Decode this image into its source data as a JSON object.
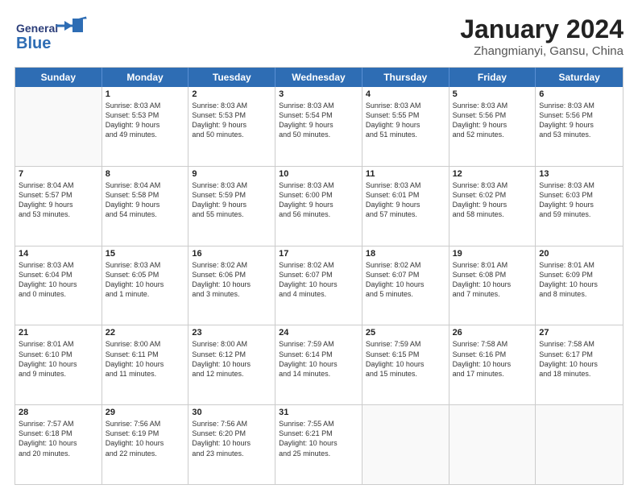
{
  "logo": {
    "general": "General",
    "blue": "Blue"
  },
  "title": "January 2024",
  "subtitle": "Zhangmianyi, Gansu, China",
  "header_days": [
    "Sunday",
    "Monday",
    "Tuesday",
    "Wednesday",
    "Thursday",
    "Friday",
    "Saturday"
  ],
  "weeks": [
    [
      {
        "day": "",
        "lines": []
      },
      {
        "day": "1",
        "lines": [
          "Sunrise: 8:03 AM",
          "Sunset: 5:53 PM",
          "Daylight: 9 hours",
          "and 49 minutes."
        ]
      },
      {
        "day": "2",
        "lines": [
          "Sunrise: 8:03 AM",
          "Sunset: 5:53 PM",
          "Daylight: 9 hours",
          "and 50 minutes."
        ]
      },
      {
        "day": "3",
        "lines": [
          "Sunrise: 8:03 AM",
          "Sunset: 5:54 PM",
          "Daylight: 9 hours",
          "and 50 minutes."
        ]
      },
      {
        "day": "4",
        "lines": [
          "Sunrise: 8:03 AM",
          "Sunset: 5:55 PM",
          "Daylight: 9 hours",
          "and 51 minutes."
        ]
      },
      {
        "day": "5",
        "lines": [
          "Sunrise: 8:03 AM",
          "Sunset: 5:56 PM",
          "Daylight: 9 hours",
          "and 52 minutes."
        ]
      },
      {
        "day": "6",
        "lines": [
          "Sunrise: 8:03 AM",
          "Sunset: 5:56 PM",
          "Daylight: 9 hours",
          "and 53 minutes."
        ]
      }
    ],
    [
      {
        "day": "7",
        "lines": [
          "Sunrise: 8:04 AM",
          "Sunset: 5:57 PM",
          "Daylight: 9 hours",
          "and 53 minutes."
        ]
      },
      {
        "day": "8",
        "lines": [
          "Sunrise: 8:04 AM",
          "Sunset: 5:58 PM",
          "Daylight: 9 hours",
          "and 54 minutes."
        ]
      },
      {
        "day": "9",
        "lines": [
          "Sunrise: 8:03 AM",
          "Sunset: 5:59 PM",
          "Daylight: 9 hours",
          "and 55 minutes."
        ]
      },
      {
        "day": "10",
        "lines": [
          "Sunrise: 8:03 AM",
          "Sunset: 6:00 PM",
          "Daylight: 9 hours",
          "and 56 minutes."
        ]
      },
      {
        "day": "11",
        "lines": [
          "Sunrise: 8:03 AM",
          "Sunset: 6:01 PM",
          "Daylight: 9 hours",
          "and 57 minutes."
        ]
      },
      {
        "day": "12",
        "lines": [
          "Sunrise: 8:03 AM",
          "Sunset: 6:02 PM",
          "Daylight: 9 hours",
          "and 58 minutes."
        ]
      },
      {
        "day": "13",
        "lines": [
          "Sunrise: 8:03 AM",
          "Sunset: 6:03 PM",
          "Daylight: 9 hours",
          "and 59 minutes."
        ]
      }
    ],
    [
      {
        "day": "14",
        "lines": [
          "Sunrise: 8:03 AM",
          "Sunset: 6:04 PM",
          "Daylight: 10 hours",
          "and 0 minutes."
        ]
      },
      {
        "day": "15",
        "lines": [
          "Sunrise: 8:03 AM",
          "Sunset: 6:05 PM",
          "Daylight: 10 hours",
          "and 1 minute."
        ]
      },
      {
        "day": "16",
        "lines": [
          "Sunrise: 8:02 AM",
          "Sunset: 6:06 PM",
          "Daylight: 10 hours",
          "and 3 minutes."
        ]
      },
      {
        "day": "17",
        "lines": [
          "Sunrise: 8:02 AM",
          "Sunset: 6:07 PM",
          "Daylight: 10 hours",
          "and 4 minutes."
        ]
      },
      {
        "day": "18",
        "lines": [
          "Sunrise: 8:02 AM",
          "Sunset: 6:07 PM",
          "Daylight: 10 hours",
          "and 5 minutes."
        ]
      },
      {
        "day": "19",
        "lines": [
          "Sunrise: 8:01 AM",
          "Sunset: 6:08 PM",
          "Daylight: 10 hours",
          "and 7 minutes."
        ]
      },
      {
        "day": "20",
        "lines": [
          "Sunrise: 8:01 AM",
          "Sunset: 6:09 PM",
          "Daylight: 10 hours",
          "and 8 minutes."
        ]
      }
    ],
    [
      {
        "day": "21",
        "lines": [
          "Sunrise: 8:01 AM",
          "Sunset: 6:10 PM",
          "Daylight: 10 hours",
          "and 9 minutes."
        ]
      },
      {
        "day": "22",
        "lines": [
          "Sunrise: 8:00 AM",
          "Sunset: 6:11 PM",
          "Daylight: 10 hours",
          "and 11 minutes."
        ]
      },
      {
        "day": "23",
        "lines": [
          "Sunrise: 8:00 AM",
          "Sunset: 6:12 PM",
          "Daylight: 10 hours",
          "and 12 minutes."
        ]
      },
      {
        "day": "24",
        "lines": [
          "Sunrise: 7:59 AM",
          "Sunset: 6:14 PM",
          "Daylight: 10 hours",
          "and 14 minutes."
        ]
      },
      {
        "day": "25",
        "lines": [
          "Sunrise: 7:59 AM",
          "Sunset: 6:15 PM",
          "Daylight: 10 hours",
          "and 15 minutes."
        ]
      },
      {
        "day": "26",
        "lines": [
          "Sunrise: 7:58 AM",
          "Sunset: 6:16 PM",
          "Daylight: 10 hours",
          "and 17 minutes."
        ]
      },
      {
        "day": "27",
        "lines": [
          "Sunrise: 7:58 AM",
          "Sunset: 6:17 PM",
          "Daylight: 10 hours",
          "and 18 minutes."
        ]
      }
    ],
    [
      {
        "day": "28",
        "lines": [
          "Sunrise: 7:57 AM",
          "Sunset: 6:18 PM",
          "Daylight: 10 hours",
          "and 20 minutes."
        ]
      },
      {
        "day": "29",
        "lines": [
          "Sunrise: 7:56 AM",
          "Sunset: 6:19 PM",
          "Daylight: 10 hours",
          "and 22 minutes."
        ]
      },
      {
        "day": "30",
        "lines": [
          "Sunrise: 7:56 AM",
          "Sunset: 6:20 PM",
          "Daylight: 10 hours",
          "and 23 minutes."
        ]
      },
      {
        "day": "31",
        "lines": [
          "Sunrise: 7:55 AM",
          "Sunset: 6:21 PM",
          "Daylight: 10 hours",
          "and 25 minutes."
        ]
      },
      {
        "day": "",
        "lines": []
      },
      {
        "day": "",
        "lines": []
      },
      {
        "day": "",
        "lines": []
      }
    ]
  ]
}
